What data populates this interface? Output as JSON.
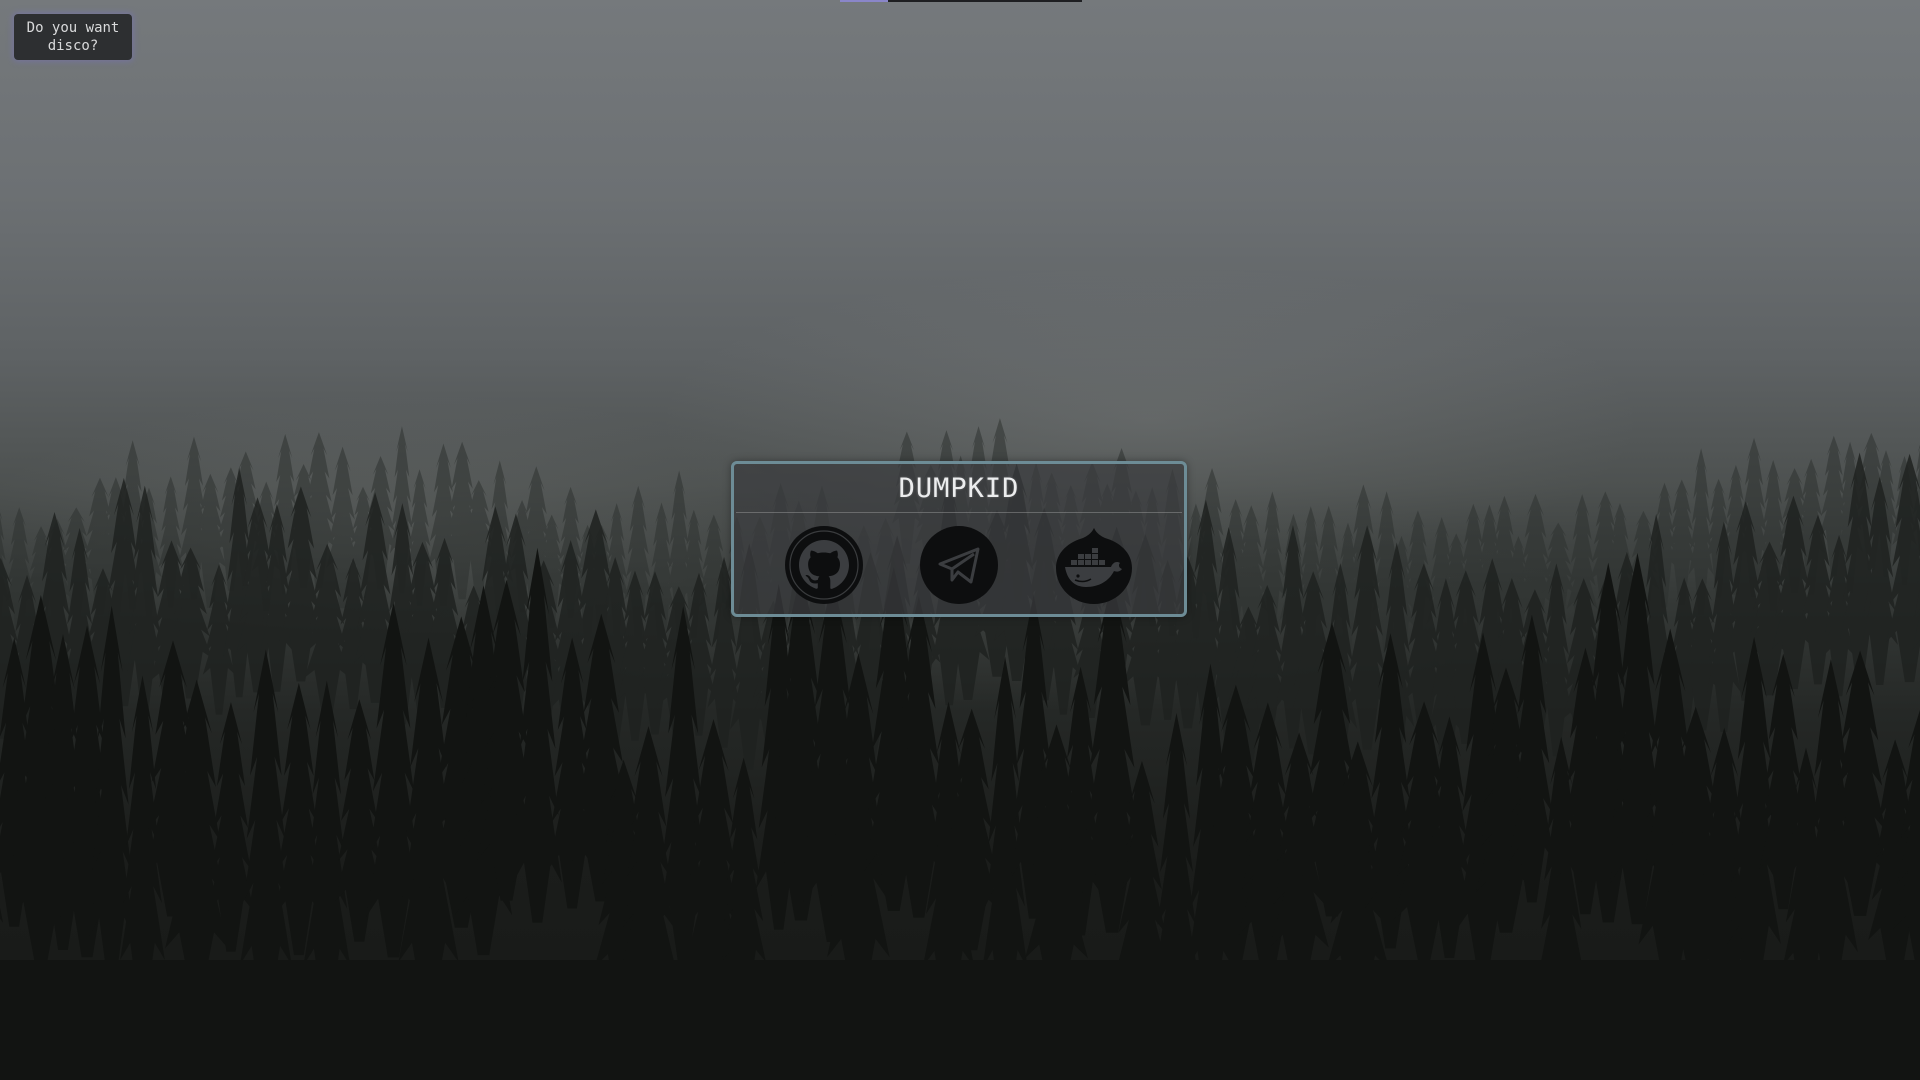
{
  "top_bar": {
    "progress_fraction": 0.2
  },
  "disco": {
    "label": "Do you want disco?",
    "glow_color": "#7873be"
  },
  "card": {
    "title": "DUMPKID",
    "border_color": "#6d8c96",
    "links": [
      {
        "icon": "github-icon"
      },
      {
        "icon": "telegram-icon"
      },
      {
        "icon": "docker-icon"
      }
    ]
  },
  "colors": {
    "accent": "#8a86c9",
    "icon": "#0d0e0f"
  }
}
